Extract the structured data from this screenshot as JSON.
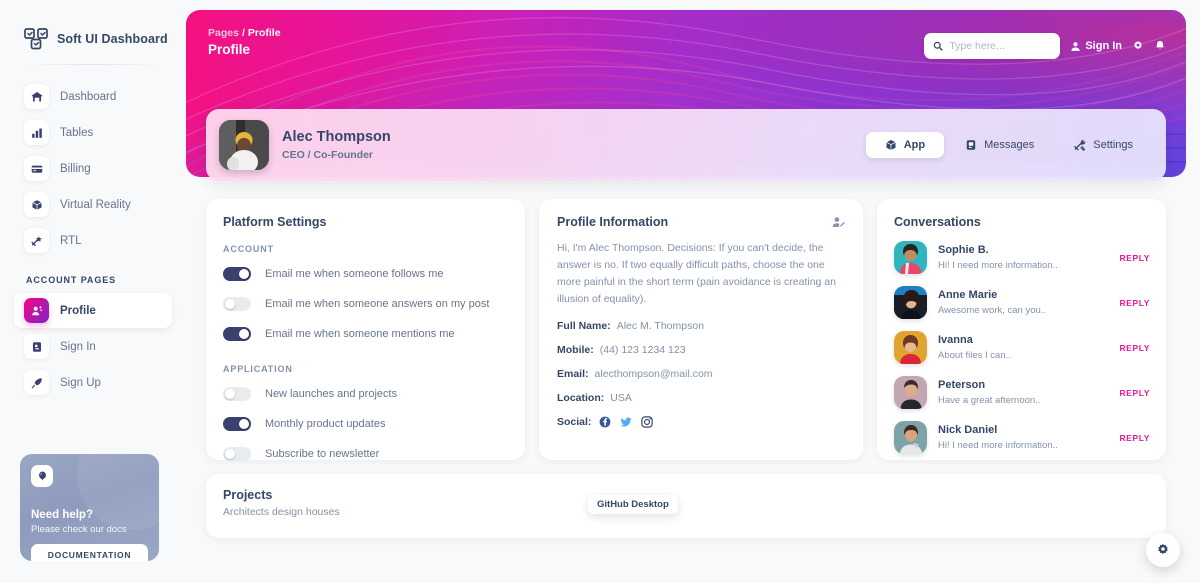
{
  "sidebar": {
    "brand": "Soft UI Dashboard",
    "brand_logo_icon": "soft-ui-logo-icon",
    "items": [
      {
        "label": "Dashboard",
        "icon": "dashboard-icon",
        "active": false
      },
      {
        "label": "Tables",
        "icon": "tables-icon",
        "active": false
      },
      {
        "label": "Billing",
        "icon": "billing-icon",
        "active": false
      },
      {
        "label": "Virtual Reality",
        "icon": "virtual-reality-icon",
        "active": false
      },
      {
        "label": "RTL",
        "icon": "rtl-icon",
        "active": false
      }
    ],
    "section_heading": "ACCOUNT PAGES",
    "account_items": [
      {
        "label": "Profile",
        "icon": "profile-icon",
        "active": true
      },
      {
        "label": "Sign In",
        "icon": "sign-in-icon",
        "active": false
      },
      {
        "label": "Sign Up",
        "icon": "sign-up-icon",
        "active": false
      }
    ],
    "help_card": {
      "icon": "help-balloon-icon",
      "title": "Need help?",
      "subtitle": "Please check our docs",
      "button_label": "DOCUMENTATION"
    }
  },
  "header": {
    "breadcrumb_root": "Pages",
    "breadcrumb_separator": "/",
    "breadcrumb_current": "Profile",
    "page_title": "Profile",
    "search": {
      "placeholder": "Type here...",
      "value": "",
      "icon": "search-icon"
    },
    "sign_in_label": "Sign In",
    "sign_in_icon": "user-icon",
    "settings_icon": "gear-icon",
    "notifications_icon": "bell-icon"
  },
  "profile_card": {
    "avatar": "user-avatar",
    "name": "Alec Thompson",
    "role": "CEO / Co-Founder",
    "tabs": [
      {
        "label": "App",
        "icon": "cube-icon",
        "active": true
      },
      {
        "label": "Messages",
        "icon": "message-icon",
        "active": false
      },
      {
        "label": "Settings",
        "icon": "tools-icon",
        "active": false
      }
    ]
  },
  "platform_settings": {
    "title": "Platform Settings",
    "groups": [
      {
        "heading": "ACCOUNT",
        "options": [
          {
            "label": "Email me when someone follows me",
            "on": true
          },
          {
            "label": "Email me when someone answers on my post",
            "on": false
          },
          {
            "label": "Email me when someone mentions me",
            "on": true
          }
        ]
      },
      {
        "heading": "APPLICATION",
        "options": [
          {
            "label": "New launches and projects",
            "on": false
          },
          {
            "label": "Monthly product updates",
            "on": true
          },
          {
            "label": "Subscribe to newsletter",
            "on": false
          }
        ]
      }
    ]
  },
  "profile_information": {
    "title": "Profile Information",
    "edit_icon": "edit-user-icon",
    "bio": "Hi, I'm Alec Thompson. Decisions: If you can't decide, the answer is no. If two equally difficult paths, choose the one more painful in the short term (pain avoidance is creating an illusion of equality).",
    "fields": [
      {
        "key": "Full Name:",
        "value": "Alec M. Thompson"
      },
      {
        "key": "Mobile:",
        "value": "(44) 123 1234 123"
      },
      {
        "key": "Email:",
        "value": "alecthompson@mail.com"
      },
      {
        "key": "Location:",
        "value": "USA"
      }
    ],
    "social_label": "Social:",
    "socials": [
      {
        "icon": "facebook-icon",
        "color": "#3b5998"
      },
      {
        "icon": "twitter-icon",
        "color": "#55acee"
      },
      {
        "icon": "instagram-icon",
        "color": "#344767"
      }
    ]
  },
  "conversations": {
    "title": "Conversations",
    "reply_label": "REPLY",
    "items": [
      {
        "name": "Sophie B.",
        "message": "Hi! I need more information..",
        "avatar_bg": "#2fb5bd",
        "hair": "#2b2320",
        "skin": "#c38a60"
      },
      {
        "name": "Anne Marie",
        "message": "Awesome work, can you..",
        "avatar_bg": "#1f7fc4",
        "hair": "#2a1a14",
        "skin": "#e3b48f"
      },
      {
        "name": "Ivanna",
        "message": "About files I can..",
        "avatar_bg": "#e0a430",
        "hair": "#6d3a22",
        "skin": "#e8b892"
      },
      {
        "name": "Peterson",
        "message": "Have a great afternoon..",
        "avatar_bg": "#b69aa6",
        "hair": "#3a2a28",
        "skin": "#dbab8e"
      },
      {
        "name": "Nick Daniel",
        "message": "Hi! I need more information..",
        "avatar_bg": "#6e9aa0",
        "hair": "#3b2a20",
        "skin": "#d9a47d"
      }
    ]
  },
  "projects": {
    "title": "Projects",
    "subtitle": "Architects design houses",
    "tooltip": "GitHub Desktop"
  },
  "fab": {
    "icon": "gear-icon"
  },
  "colors": {
    "accent_pink": "#e5189e",
    "brand_dark": "#344767",
    "muted": "#8392ab",
    "toggle_on": "#3a416f",
    "gradient_start": "#7928ca",
    "gradient_end": "#ff0080"
  }
}
